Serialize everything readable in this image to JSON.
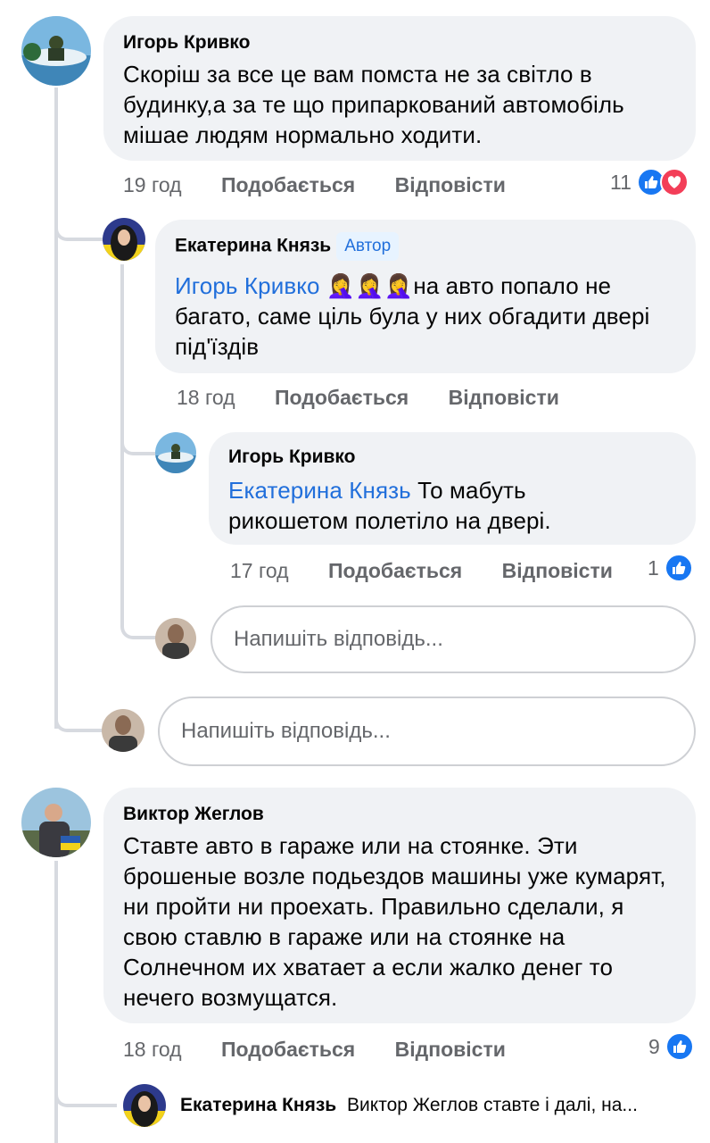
{
  "comments": [
    {
      "author": "Игорь Кривко",
      "text": "Скоріш за все це вам помста не за світло в будинку,а за те що припаркований автомобіль мішае людям нормально ходити.",
      "time": "19 год",
      "like_label": "Подобається",
      "reply_label": "Відповісти",
      "reactions": "11",
      "replies": [
        {
          "author": "Екатерина Князь",
          "badge": "Автор",
          "mention": "Игорь Кривко",
          "emoji": "🤦‍♀️🤦‍♀️🤦‍♀️",
          "text": "на авто попало не багато, саме ціль була у них обгадити двері під'їздів",
          "time": "18 год",
          "like_label": "Подобається",
          "reply_label": "Відповісти"
        },
        {
          "author": "Игорь Кривко",
          "mention": "Екатерина Князь",
          "text": " То мабуть рикошетом полетіло на двері.",
          "time": "17 год",
          "like_label": "Подобається",
          "reply_label": "Відповісти",
          "reactions": "1"
        }
      ]
    },
    {
      "author": "Виктор Жеглов",
      "text": "Ставте авто в гараже или на стоянке. Эти брошеные возле подьездов машины уже кумарят, ни пройти ни проехать. Правильно сделали, я свою ставлю в гараже или на стоянке на Солнечном их хватает а если жалко денег то нечего возмущатся.",
      "time": "18 год",
      "like_label": "Подобається",
      "reply_label": "Відповісти",
      "reactions": "9",
      "reply_preview": {
        "author": "Екатерина Князь",
        "text": "Виктор Жеглов ставте і далі, на..."
      }
    }
  ],
  "reply_placeholder": "Напишіть відповідь..."
}
